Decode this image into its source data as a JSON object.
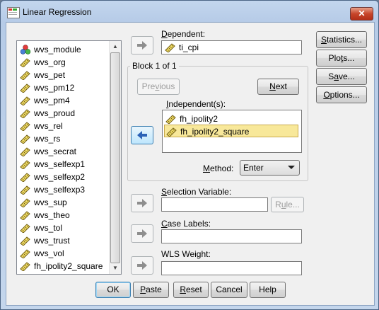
{
  "window": {
    "title": "Linear Regression",
    "close_glyph": "✕"
  },
  "variables": [
    {
      "name": "wvs_module",
      "icon": "nominal-icon"
    },
    {
      "name": "wvs_org",
      "icon": "scale-ruler-icon"
    },
    {
      "name": "wvs_pet",
      "icon": "scale-ruler-icon"
    },
    {
      "name": "wvs_pm12",
      "icon": "scale-ruler-icon"
    },
    {
      "name": "wvs_pm4",
      "icon": "scale-ruler-icon"
    },
    {
      "name": "wvs_proud",
      "icon": "scale-ruler-icon"
    },
    {
      "name": "wvs_rel",
      "icon": "scale-ruler-icon"
    },
    {
      "name": "wvs_rs",
      "icon": "scale-ruler-icon"
    },
    {
      "name": "wvs_secrat",
      "icon": "scale-ruler-icon"
    },
    {
      "name": "wvs_selfexp1",
      "icon": "scale-ruler-icon"
    },
    {
      "name": "wvs_selfexp2",
      "icon": "scale-ruler-icon"
    },
    {
      "name": "wvs_selfexp3",
      "icon": "scale-ruler-icon"
    },
    {
      "name": "wvs_sup",
      "icon": "scale-ruler-icon"
    },
    {
      "name": "wvs_theo",
      "icon": "scale-ruler-icon"
    },
    {
      "name": "wvs_tol",
      "icon": "scale-ruler-icon"
    },
    {
      "name": "wvs_trust",
      "icon": "scale-ruler-icon"
    },
    {
      "name": "wvs_vol",
      "icon": "scale-ruler-icon"
    },
    {
      "name": "fh_ipolity2_square",
      "icon": "scale-ruler-icon"
    }
  ],
  "dependent": {
    "label_pre": "",
    "label_key": "D",
    "label_post": "ependent:",
    "value": "ti_cpi"
  },
  "block": {
    "title": "Block 1 of 1",
    "previous_pre": "Pre",
    "previous_key": "v",
    "previous_post": "ious",
    "next_key": "N",
    "next_post": "ext"
  },
  "independent": {
    "label_pre": "",
    "label_key": "I",
    "label_post": "ndependent(s):",
    "items": [
      "fh_ipolity2",
      "fh_ipolity2_square"
    ],
    "selected_index": 1
  },
  "method": {
    "label_pre": "",
    "label_key": "M",
    "label_post": "ethod:",
    "value": "Enter"
  },
  "selection": {
    "label_pre": "",
    "label_key": "S",
    "label_post": "election Variable:",
    "value": "",
    "rule_pre": "R",
    "rule_key": "u",
    "rule_post": "le..."
  },
  "case_labels": {
    "label_pre": "",
    "label_key": "C",
    "label_post": "ase Labels:",
    "value": ""
  },
  "wls": {
    "label_pre": "WLS Wei",
    "label_key": "g",
    "label_post": "ht:",
    "value": ""
  },
  "side_buttons": {
    "statistics": {
      "pre": "",
      "key": "S",
      "post": "tatistics..."
    },
    "plots": {
      "pre": "Plo",
      "key": "t",
      "post": "s..."
    },
    "save": {
      "pre": "S",
      "key": "a",
      "post": "ve..."
    },
    "options": {
      "pre": "",
      "key": "O",
      "post": "ptions..."
    }
  },
  "bottom_buttons": {
    "ok": "OK",
    "paste": {
      "pre": "",
      "key": "P",
      "post": "aste"
    },
    "reset": {
      "pre": "",
      "key": "R",
      "post": "eset"
    },
    "cancel": "Cancel",
    "help": "Help"
  },
  "colors": {
    "selection_fill": "#f8e89a",
    "title_gradient": "#c3d6ee",
    "close_button": "#c7452a",
    "arrow_blue": "#2b62b7"
  }
}
